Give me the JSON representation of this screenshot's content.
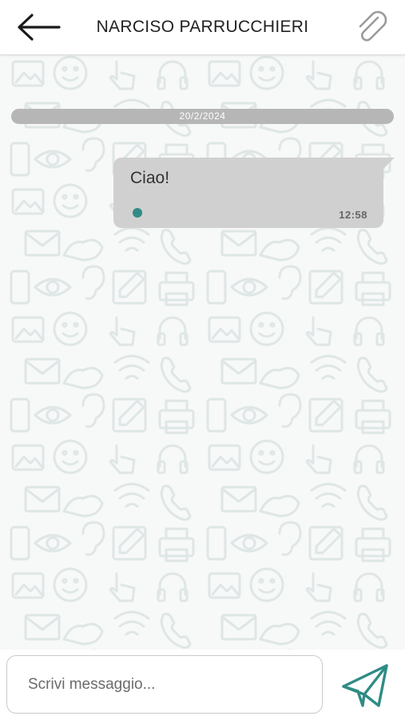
{
  "header": {
    "title": "NARCISO PARRUCCHIERI"
  },
  "chat": {
    "date_separator": "20/2/2024",
    "messages": [
      {
        "text": "Ciao!",
        "time": "12:58"
      }
    ]
  },
  "composer": {
    "placeholder": "Scrivi messaggio...",
    "value": ""
  },
  "icons": {
    "back": "arrow-left-icon",
    "attach": "paperclip-icon",
    "send": "paper-plane-icon",
    "status": "dot-icon"
  },
  "colors": {
    "accent": "#2f8c85",
    "bubble": "#d0d0d0",
    "date_pill": "#b6b6b6",
    "pattern": "#dfe6e6"
  }
}
